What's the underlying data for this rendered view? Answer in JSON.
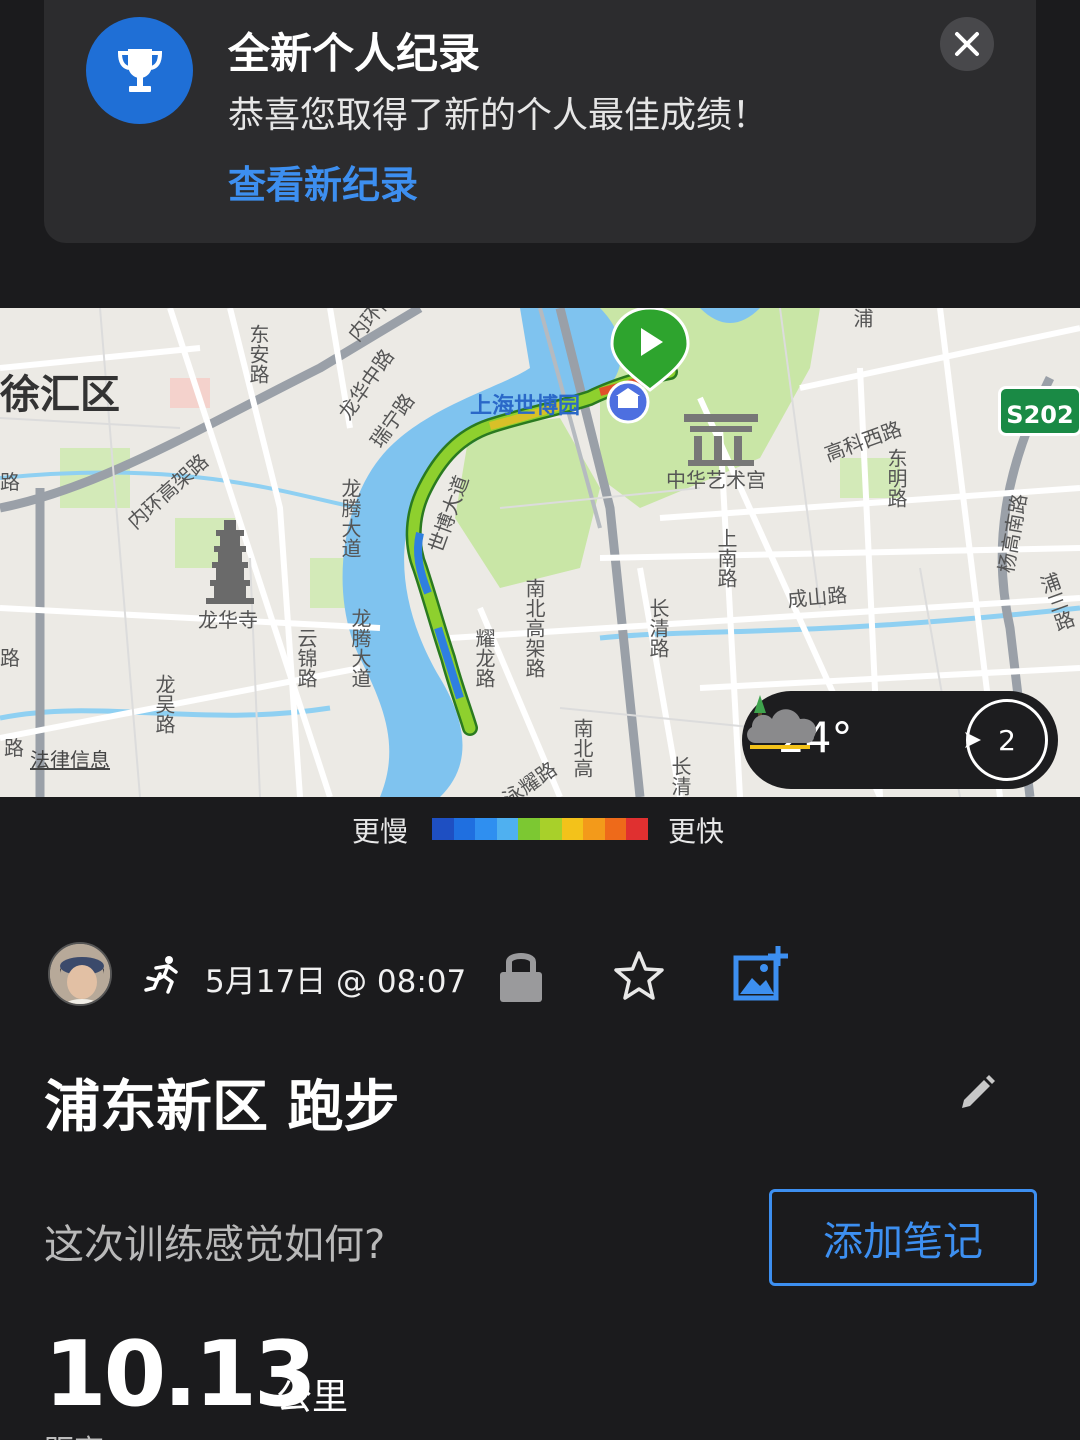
{
  "notification": {
    "title": "全新个人纪录",
    "body": "恭喜您取得了新的个人最佳成绩！",
    "link": "查看新纪录",
    "icon": "trophy-icon",
    "accent": "#1f6fd6"
  },
  "map": {
    "labels": {
      "district": "徐汇区",
      "dongan": "东安路",
      "neihuan_top": "内环高架",
      "longhua_zhong": "龙华中路",
      "ruining": "瑞宁路",
      "neihuan_left": "内环高架路",
      "expo_park": "上海世博园",
      "art_palace": "中华艺术宫",
      "gaoke": "高科西路",
      "dongming": "东明路",
      "yanggao": "杨高南路",
      "pusan": "浦三路",
      "pu_top": "浦",
      "shibo_ave": "世博大道",
      "longteng_top": "龙腾大道",
      "longteng_bottom": "龙腾大道",
      "longhua_temple": "龙华寺",
      "yunjin": "云锦路",
      "longwu": "龙吴路",
      "legal": "法律信息",
      "yaolong": "耀龙路",
      "nanbei_top": "南北高架路",
      "nanbei_bottom": "南北高",
      "changqing": "长清路",
      "shangnan": "上南路",
      "chengshan": "成山路",
      "yongyao": "泳耀路",
      "chang_bottom": "长清",
      "lu_left": "路",
      "lu_left2": "路",
      "lu_bottom_left": "路"
    },
    "highway_shield": "S202",
    "weather": {
      "temperature": "24°",
      "wind": "2",
      "icon": "cloud-icon"
    }
  },
  "legend": {
    "slow": "更慢",
    "fast": "更快",
    "colors": [
      "#1e4fc2",
      "#1f6fe0",
      "#2f8ff0",
      "#4fb0f0",
      "#7cc832",
      "#a8d02a",
      "#f3c21a",
      "#f39a1a",
      "#ee6a1a",
      "#e03030"
    ]
  },
  "activity": {
    "datetime": "5月17日 @ 08:07",
    "title": "浦东新区 跑步",
    "feel_prompt": "这次训练感觉如何?",
    "add_note": "添加笔记",
    "distance": "10.13",
    "distance_unit": "公里",
    "distance_label": "距离"
  }
}
